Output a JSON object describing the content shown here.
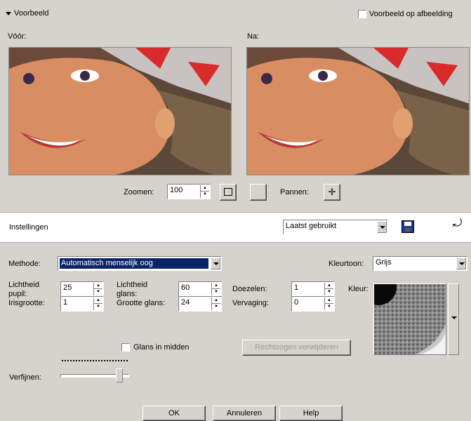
{
  "preview": {
    "header_label": "Voorbeeld",
    "on_image_label": "Voorbeeld op afbeelding",
    "before_label": "Vóór:",
    "after_label": "Na:",
    "zoom_label": "Zoomen:",
    "zoom_value": "100",
    "pan_label": "Pannen:"
  },
  "settings": {
    "title": "Instellingen",
    "preset_value": "Laatst gebruikt"
  },
  "form": {
    "method_label": "Methode:",
    "method_value": "Automatisch menselijk oog",
    "color_label": "Kleurtoon:",
    "color_value": "Grijs",
    "pupil_brightness_label_1": "Lichtheid",
    "pupil_brightness_label_2": "pupil:",
    "pupil_brightness_value": "25",
    "glare_brightness_label_1": "Lichtheid",
    "glare_brightness_label_2": "glans:",
    "glare_brightness_value": "60",
    "blur_label": "Doezelen:",
    "blur_value": "1",
    "iris_label": "Irisgrootte:",
    "iris_value": "1",
    "glare_size_label": "Grootte glans:",
    "glare_size_value": "24",
    "feather_label": "Vervaging:",
    "feather_value": "0",
    "swatch_label": "Kleur:",
    "center_glare_label": "Glans in midden",
    "restore_label": "Rechtoogen verwijderen",
    "refine_label": "Verfijnen:",
    "refine_level": 0.9
  },
  "buttons": {
    "ok": "OK",
    "cancel": "Annuleren",
    "help": "Help"
  },
  "colors": {
    "dialog_bg": "#d6d3ce",
    "selection": "#0a246a"
  }
}
